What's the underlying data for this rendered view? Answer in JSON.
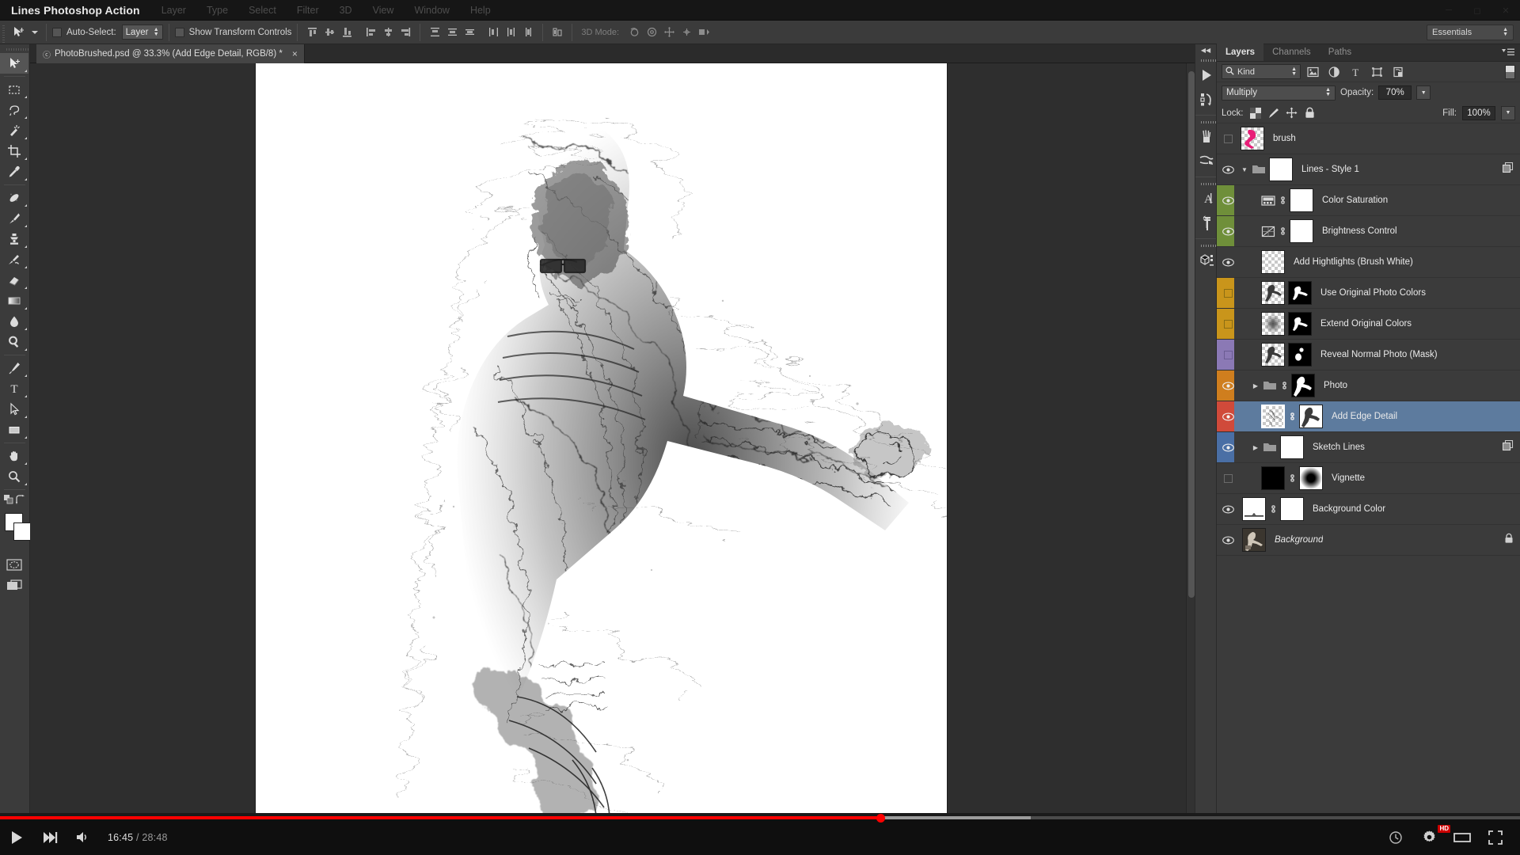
{
  "window": {
    "app_title": "Lines Photoshop Action",
    "menus": [
      "Layer",
      "Type",
      "Select",
      "Filter",
      "3D",
      "View",
      "Window",
      "Help"
    ],
    "controls": [
      "minimize",
      "maximize",
      "close"
    ]
  },
  "options_bar": {
    "move_tool_icon": "move-tool-icon",
    "auto_select_label": "Auto-Select:",
    "auto_select_value": "Layer",
    "auto_select_checked": false,
    "show_transform_label": "Show Transform Controls",
    "show_transform_checked": false,
    "align_icons": [
      "align-top-edges-icon",
      "align-vertical-centers-icon",
      "align-bottom-edges-icon",
      "align-left-edges-icon",
      "align-horizontal-centers-icon",
      "align-right-edges-icon"
    ],
    "distribute_icons": [
      "distribute-top-edges-icon",
      "distribute-vertical-centers-icon",
      "distribute-bottom-edges-icon",
      "distribute-left-edges-icon",
      "distribute-horizontal-centers-icon",
      "distribute-right-edges-icon"
    ],
    "auto_align_icon": "auto-align-layers-icon",
    "mode_3d_label": "3D Mode:",
    "mode_3d_icons": [
      "rotate-3d-icon",
      "roll-3d-icon",
      "drag-3d-icon",
      "slide-3d-icon",
      "scale-3d-icon"
    ],
    "workspace": "Essentials"
  },
  "document": {
    "tab_title": "PhotoBrushed.psd @ 33.3% (Add Edge Detail, RGB/8) *",
    "zoom": "33.3%",
    "close_glyph": "×",
    "cloud_glyph": "ⓒ"
  },
  "toolbar": {
    "groups": [
      [
        "move-tool-icon"
      ],
      [
        "rectangular-marquee-tool-icon",
        "lasso-tool-icon",
        "magic-wand-tool-icon",
        "crop-tool-icon",
        "eyedropper-tool-icon"
      ],
      [
        "spot-healing-brush-tool-icon",
        "brush-tool-icon",
        "clone-stamp-tool-icon",
        "history-brush-tool-icon",
        "eraser-tool-icon",
        "gradient-tool-icon",
        "blur-tool-icon",
        "dodge-tool-icon"
      ],
      [
        "pen-tool-icon",
        "horizontal-type-tool-icon",
        "path-selection-tool-icon",
        "rectangle-tool-icon"
      ],
      [
        "hand-tool-icon",
        "zoom-tool-icon"
      ]
    ],
    "foreground_color": "#ffffff",
    "background_color": "#ffffff",
    "quick_mask_icon": "edit-in-quick-mask-mode-icon",
    "screen_mode_icon": "change-screen-mode-icon",
    "default_colors_icon": "default-colors-icon",
    "swap_colors_icon": "swap-colors-icon"
  },
  "rail": {
    "collapse_glyph": "◀◀",
    "icons": [
      "history-panel-icon",
      "actions-panel-icon",
      "brush-panel-icon",
      "brush-settings-panel-icon",
      "character-panel-icon",
      "paragraph-panel-icon",
      "3d-panel-icon"
    ]
  },
  "layers_panel": {
    "tabs": [
      {
        "label": "Layers",
        "active": true
      },
      {
        "label": "Channels",
        "active": false
      },
      {
        "label": "Paths",
        "active": false
      }
    ],
    "menu_icon": "panel-menu-icon",
    "filter": {
      "kind_label": "Kind",
      "search_icon": "search-icon",
      "type_filters": [
        "filter-pixel-layers-icon",
        "filter-adjustment-layers-icon",
        "filter-type-layers-icon",
        "filter-shape-layers-icon",
        "filter-smart-objects-icon"
      ],
      "toggle_icon": "filter-toggle-switch-icon"
    },
    "blend_mode": "Multiply",
    "opacity_label": "Opacity:",
    "opacity_value": "70%",
    "fill_label": "Fill:",
    "fill_value": "100%",
    "lock_label": "Lock:",
    "lock_icons": [
      "lock-transparent-pixels-icon",
      "lock-image-pixels-icon",
      "lock-position-icon",
      "lock-all-icon"
    ],
    "layers": [
      {
        "name": "brush",
        "visible": false,
        "selected": false,
        "color": null,
        "indent": 0,
        "kind": "pixel",
        "thumb": "brush-pink",
        "has_mask": false,
        "linked": false,
        "disclosure": null,
        "badge": null
      },
      {
        "name": "Lines - Style 1",
        "visible": true,
        "selected": false,
        "color": null,
        "indent": 0,
        "kind": "group",
        "thumb": "white",
        "has_mask": true,
        "linked": false,
        "disclosure": "open",
        "badge": "clipped-group-icon"
      },
      {
        "name": "Color Saturation",
        "visible": true,
        "selected": false,
        "color": "#6f8f3a",
        "indent": 1,
        "kind": "adjustment-hue-saturation",
        "thumb": "white",
        "has_mask": true,
        "linked": true,
        "disclosure": null,
        "badge": null
      },
      {
        "name": "Brightness Control",
        "visible": true,
        "selected": false,
        "color": "#6f8f3a",
        "indent": 1,
        "kind": "adjustment-curves",
        "thumb": "white",
        "has_mask": true,
        "linked": true,
        "disclosure": null,
        "badge": null
      },
      {
        "name": "Add Hightlights (Brush White)",
        "visible": true,
        "selected": false,
        "color": null,
        "indent": 1,
        "kind": "pixel",
        "thumb": "checker",
        "has_mask": false,
        "linked": false,
        "disclosure": null,
        "badge": null
      },
      {
        "name": "Use Original Photo Colors",
        "visible": false,
        "selected": false,
        "color": "#c9951b",
        "indent": 1,
        "kind": "pixel",
        "thumb": "figure-checker",
        "has_mask": true,
        "linked": false,
        "disclosure": null,
        "badge": null
      },
      {
        "name": "Extend Original Colors",
        "visible": false,
        "selected": false,
        "color": "#c9951b",
        "indent": 1,
        "kind": "pixel",
        "thumb": "blur-checker",
        "has_mask": true,
        "linked": false,
        "disclosure": null,
        "badge": null
      },
      {
        "name": "Reveal Normal Photo (Mask)",
        "visible": false,
        "selected": false,
        "color": "#8b79b5",
        "indent": 1,
        "kind": "pixel",
        "thumb": "figure-checker",
        "has_mask": true,
        "linked": false,
        "disclosure": null,
        "badge": null
      },
      {
        "name": "Photo",
        "visible": true,
        "selected": false,
        "color": "#cf7e1e",
        "indent": 1,
        "kind": "group",
        "thumb": "mask-figure",
        "has_mask": true,
        "linked": true,
        "disclosure": "closed",
        "badge": null
      },
      {
        "name": "Add Edge Detail",
        "visible": true,
        "selected": true,
        "color": "#d04a3a",
        "indent": 1,
        "kind": "pixel",
        "thumb": "sketch-checker",
        "has_mask": true,
        "linked": true,
        "disclosure": null,
        "badge": null
      },
      {
        "name": "Sketch Lines",
        "visible": true,
        "selected": false,
        "color": "#4a6fa5",
        "indent": 0,
        "kind": "group",
        "thumb": "white",
        "has_mask": true,
        "linked": false,
        "disclosure": "closed",
        "badge": "clipped-group-icon"
      },
      {
        "name": "Vignette",
        "visible": false,
        "selected": false,
        "color": null,
        "indent": 0,
        "kind": "fill-solid",
        "thumb": "black",
        "has_mask": true,
        "linked": true,
        "disclosure": null,
        "badge": null
      },
      {
        "name": "Background Color",
        "visible": true,
        "selected": false,
        "color": null,
        "indent": 0,
        "kind": "fill-gradient",
        "thumb": "white-gradient",
        "has_mask": true,
        "linked": true,
        "disclosure": null,
        "badge": null
      },
      {
        "name": "Background",
        "visible": true,
        "selected": false,
        "color": null,
        "indent": 0,
        "kind": "background",
        "thumb": "photo-dark",
        "has_mask": false,
        "linked": false,
        "disclosure": null,
        "badge": "lock-icon",
        "italic": true
      }
    ]
  },
  "video_player": {
    "play_icon": "play-icon",
    "next_icon": "next-video-icon",
    "volume_icon": "volume-icon",
    "current_time": "16:45",
    "separator": "/",
    "total_time": "28:48",
    "autoplay_icon": "autoplay-toggle-icon",
    "subtitles_icon": "subtitles-icon",
    "settings_icon": "settings-gear-icon",
    "quality_badge": "HD",
    "theater_icon": "theater-mode-icon",
    "fullscreen_icon": "fullscreen-icon",
    "progress_percent": 58,
    "buffered_percent": 68,
    "progress_color": "#ff0000"
  }
}
